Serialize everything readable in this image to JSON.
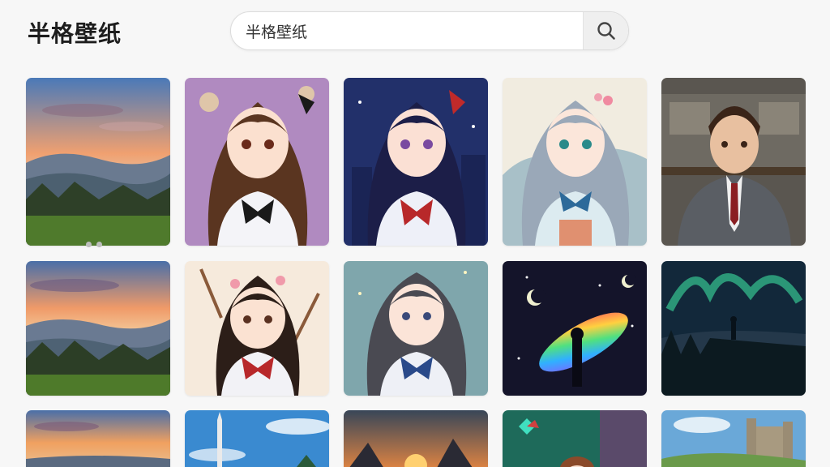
{
  "app": {
    "title": "半格壁纸"
  },
  "search": {
    "value": "半格壁纸",
    "placeholder": ""
  },
  "colors": {
    "background": "#f7f7f7",
    "search_button_bg": "#efefef"
  },
  "carousel": {
    "dot_count": 2
  },
  "grid": {
    "rows": [
      [
        "landscape-sunset-valley",
        "anime-girl-brown-hair-bow",
        "anime-girl-night-city",
        "anime-girl-silver-hair-sailor",
        "anime-man-suit-tie"
      ],
      [
        "landscape-sunset-misty-hills",
        "anime-girl-flowers-branches",
        "anime-girl-grey-hair-sparkles",
        "cosmic-rainbow-ring-silhouette",
        "aurora-forest-silhouette"
      ],
      [
        "sunset-clouds-lake",
        "rocket-tower-sky",
        "mountain-sunset",
        "anime-character-portal",
        "castle-landscape"
      ]
    ]
  }
}
